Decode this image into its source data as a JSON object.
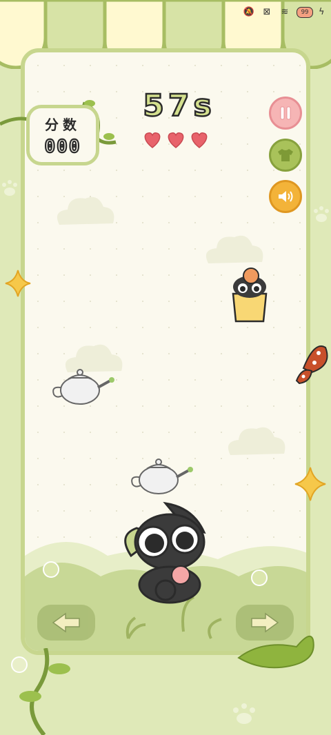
{
  "status_bar": {
    "icons": [
      "mute-vibrate-icon",
      "no-sim-icon",
      "wifi-icon",
      "battery-icon",
      "charging-icon"
    ],
    "battery_level": "99"
  },
  "hud": {
    "score_label": "分数",
    "score_value": "000",
    "timer": "57s",
    "lives_total": 3,
    "lives_remaining": 3
  },
  "buttons": {
    "pause": "pause-icon",
    "outfit": "shirt-icon",
    "sound": "speaker-icon",
    "move_left": "arrow-left-icon",
    "move_right": "arrow-right-icon"
  },
  "colors": {
    "frame_green": "#c7d68e",
    "board_bg": "#fbf9ee",
    "pause_pink": "#f6b5b5",
    "outfit_green": "#a9c25a",
    "sound_orange": "#f3b339",
    "heart_red": "#e8636b"
  }
}
